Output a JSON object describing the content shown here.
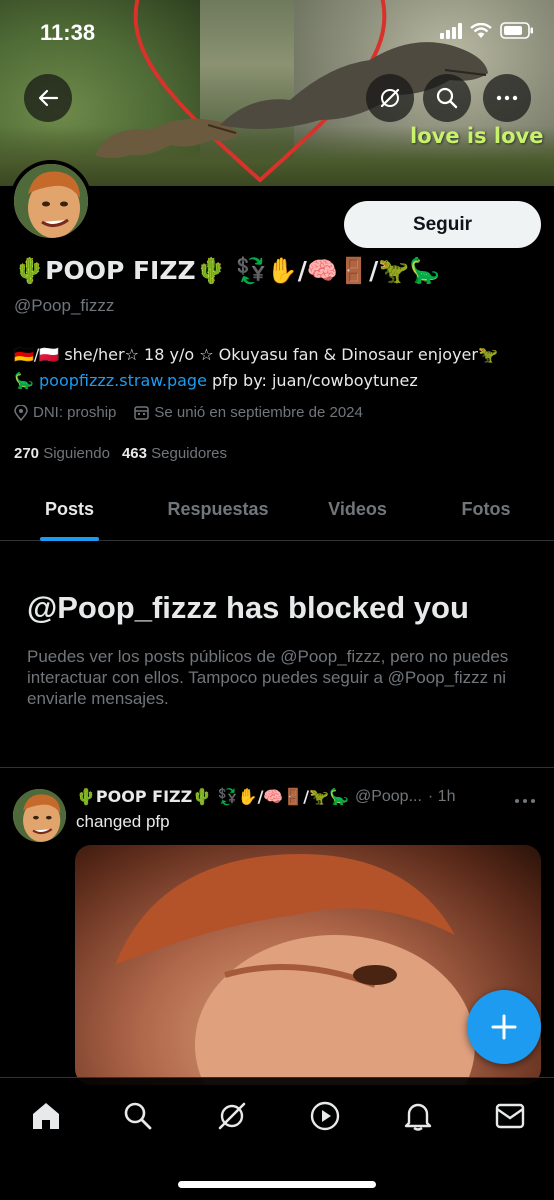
{
  "status_bar": {
    "time": "11:38"
  },
  "banner": {
    "overlay_text": "love is love"
  },
  "profile": {
    "follow_label": "Seguir",
    "display_name": "🌵POOP FIZZ🌵 💱✋/🧠🚪/🦖🦕",
    "handle": "@Poop_fizzz",
    "bio_line1": "🇩🇪/🇵🇱 she/her☆ 18 y/o ☆ Okuyasu fan & Dinosaur enjoyer🦖",
    "bio_line2_prefix": "🦕 ",
    "bio_link": "poopfizzz.straw.page",
    "bio_line2_suffix": " pfp by: juan/cowboytunez",
    "location": "DNI: proship",
    "joined": "Se unió en septiembre de 2024",
    "following_count": "270",
    "following_label": "Siguiendo",
    "followers_count": "463",
    "followers_label": "Seguidores"
  },
  "tabs": [
    {
      "label": "Posts",
      "active": true
    },
    {
      "label": "Respuestas",
      "active": false
    },
    {
      "label": "Videos",
      "active": false
    },
    {
      "label": "Fotos",
      "active": false
    }
  ],
  "blocked": {
    "title": "@Poop_fizzz has blocked you",
    "description": "Puedes ver los posts públicos de @Poop_fizzz, pero no puedes interactuar con ellos. Tampoco puedes seguir a @Poop_fizzz ni enviarle mensajes."
  },
  "post": {
    "name": "🌵POOP FIZZ🌵 💱✋/🧠🚪/🦖🦕",
    "handle": "@Poop...",
    "time": "· 1h",
    "text": "changed pfp"
  },
  "bottom_nav": {
    "items": [
      "home-icon",
      "search-icon",
      "grok-icon",
      "video-icon",
      "notifications-icon",
      "messages-icon"
    ]
  },
  "colors": {
    "accent": "#1d9bf0",
    "background": "#000000",
    "muted": "#71767b"
  }
}
